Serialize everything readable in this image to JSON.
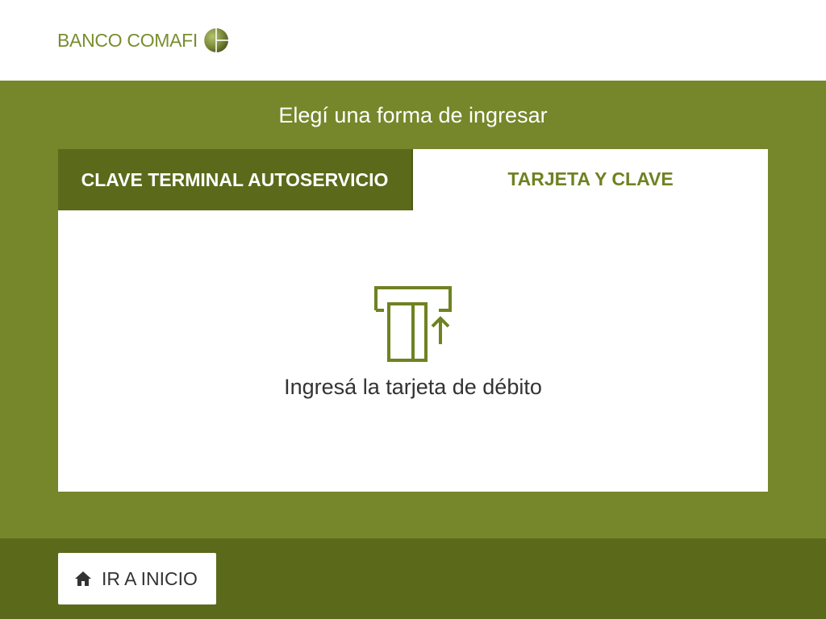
{
  "header": {
    "logo_text": "BANCO COMAFI",
    "logo_icon": "globe-icon"
  },
  "main": {
    "title": "Elegí una forma de ingresar",
    "tabs": [
      {
        "label": "CLAVE TERMINAL AUTOSERVICIO",
        "selected": false
      },
      {
        "label": "TARJETA Y CLAVE",
        "selected": true
      }
    ],
    "content": {
      "icon": "card-insert-icon",
      "instruction": "Ingresá la tarjeta de débito"
    }
  },
  "footer": {
    "home_button": {
      "icon": "home-icon",
      "label": "IR A INICIO"
    }
  },
  "colors": {
    "brand_green": "#76862a",
    "dark_green": "#5a6a1a",
    "accent_text": "#6e8222"
  }
}
